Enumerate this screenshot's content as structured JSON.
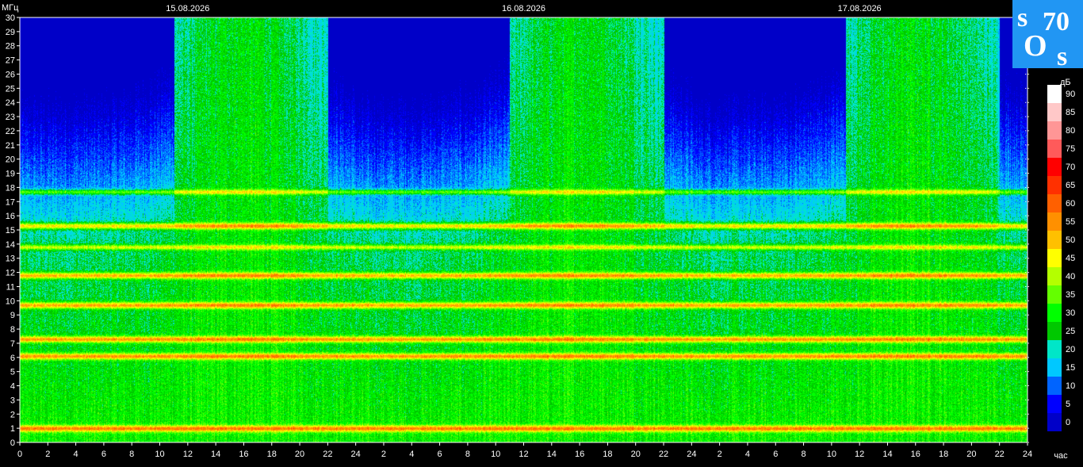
{
  "chart_data": {
    "type": "heatmap",
    "title": "",
    "ylabel": "МГц",
    "xlabel": "час",
    "dates": [
      "15.08.2026",
      "16.08.2026",
      "17.08.2026"
    ],
    "x_ticks": [
      "0",
      "2",
      "4",
      "6",
      "8",
      "10",
      "12",
      "14",
      "16",
      "18",
      "20",
      "22",
      "24",
      "2",
      "4",
      "6",
      "8",
      "10",
      "12",
      "14",
      "16",
      "18",
      "20",
      "22",
      "24",
      "2",
      "4",
      "6",
      "8",
      "10",
      "12",
      "14",
      "16",
      "18",
      "20",
      "22",
      "24"
    ],
    "y_ticks": [
      "0",
      "1",
      "2",
      "3",
      "4",
      "5",
      "6",
      "7",
      "8",
      "9",
      "10",
      "11",
      "12",
      "13",
      "14",
      "15",
      "16",
      "17",
      "18",
      "19",
      "20",
      "21",
      "22",
      "23",
      "24",
      "25",
      "26",
      "27",
      "28",
      "29",
      "30"
    ],
    "ylim": [
      0,
      30
    ],
    "xlim_hours": [
      0,
      72
    ],
    "colorbar": {
      "unit": "дБ",
      "ticks": [
        "90",
        "85",
        "80",
        "75",
        "70",
        "65",
        "60",
        "55",
        "50",
        "45",
        "40",
        "35",
        "30",
        "25",
        "20",
        "15",
        "10",
        "5",
        "0"
      ],
      "colors": [
        "#ffffff",
        "#ffc8c8",
        "#ff9696",
        "#ff5a5a",
        "#ff0000",
        "#ff3000",
        "#ff6000",
        "#ff9000",
        "#ffc000",
        "#ffff00",
        "#b4ff00",
        "#64ff00",
        "#00ff00",
        "#00c800",
        "#00e6c8",
        "#00c8ff",
        "#0064ff",
        "#0000ff",
        "#0000c8"
      ]
    },
    "bands_mhz": [
      {
        "f": 1.0,
        "strength": "high"
      },
      {
        "f": 6.1,
        "strength": "high"
      },
      {
        "f": 7.3,
        "strength": "high"
      },
      {
        "f": 9.7,
        "strength": "high"
      },
      {
        "f": 11.8,
        "strength": "high"
      },
      {
        "f": 13.8,
        "strength": "medium"
      },
      {
        "f": 15.3,
        "strength": "high"
      },
      {
        "f": 17.7,
        "strength": "medium"
      }
    ]
  },
  "logo": {
    "text_top": "s",
    "number": "70",
    "text_mid": "O",
    "text_bottom": "s"
  }
}
